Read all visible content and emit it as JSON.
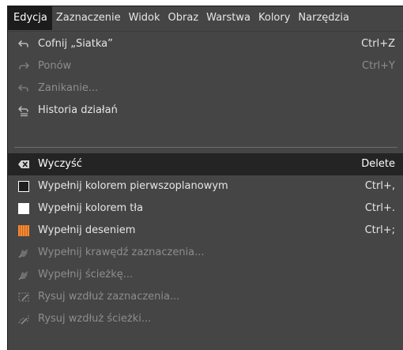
{
  "menubar": {
    "items": [
      {
        "label": "Edycja",
        "active": true
      },
      {
        "label": "Zaznaczenie"
      },
      {
        "label": "Widok"
      },
      {
        "label": "Obraz"
      },
      {
        "label": "Warstwa"
      },
      {
        "label": "Kolory"
      },
      {
        "label": "Narzędzia"
      }
    ]
  },
  "menu": {
    "items": [
      {
        "label": "Cofnij „Siatka”",
        "shortcut": "Ctrl+Z",
        "icon": "undo-icon"
      },
      {
        "label": "Ponów",
        "shortcut": "Ctrl+Y",
        "icon": "redo-icon",
        "disabled": true
      },
      {
        "label": "Zanikanie...",
        "shortcut": "",
        "icon": "fade-icon",
        "disabled": true
      },
      {
        "label": "Historia działań",
        "shortcut": "",
        "icon": "history-icon"
      },
      {
        "label": "Wyczyść",
        "shortcut": "Delete",
        "icon": "clear-icon",
        "highlighted": true
      },
      {
        "label": "Wypełnij kolorem pierwszoplanowym",
        "shortcut": "Ctrl+,",
        "icon": "fg-color-swatch-icon"
      },
      {
        "label": "Wypełnij kolorem tła",
        "shortcut": "Ctrl+.",
        "icon": "bg-color-swatch-icon"
      },
      {
        "label": "Wypełnij deseniem",
        "shortcut": "Ctrl+;",
        "icon": "pattern-swatch-icon"
      },
      {
        "label": "Wypełnij krawędź zaznaczenia...",
        "shortcut": "",
        "icon": "stroke-selection-fill-icon",
        "disabled": true
      },
      {
        "label": "Wypełnij ścieżkę...",
        "shortcut": "",
        "icon": "fill-path-icon",
        "disabled": true
      },
      {
        "label": "Rysuj wzdłuż zaznaczenia...",
        "shortcut": "",
        "icon": "stroke-selection-icon",
        "disabled": true
      },
      {
        "label": "Rysuj wzdłuż ścieżki...",
        "shortcut": "",
        "icon": "stroke-path-icon",
        "disabled": true
      }
    ]
  },
  "colors": {
    "foreground_swatch": "#1e1e1e",
    "background_swatch": "#ffffff",
    "pattern_swatch": "#e07a2a",
    "highlight": "#242424",
    "menu_bg": "#454545"
  }
}
